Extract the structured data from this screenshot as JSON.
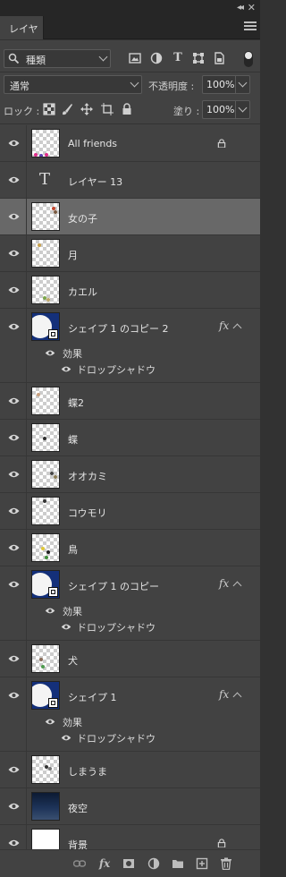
{
  "panel": {
    "tab_label": "レイヤー",
    "filter": {
      "label": "種類"
    },
    "blend_mode": "通常",
    "opacity_label": "不透明度 :",
    "opacity_value": "100%",
    "lock_label": "ロック :",
    "fill_label": "塗り :",
    "fill_value": "100%"
  },
  "layers": [
    {
      "name": "All friends",
      "type": "pixel",
      "locked": true,
      "selected": false
    },
    {
      "name": "レイヤー 13",
      "type": "text",
      "locked": false,
      "selected": false
    },
    {
      "name": "女の子",
      "type": "pixel",
      "locked": false,
      "selected": true
    },
    {
      "name": "月",
      "type": "pixel",
      "locked": false,
      "selected": false
    },
    {
      "name": "カエル",
      "type": "pixel",
      "locked": false,
      "selected": false
    },
    {
      "name": "シェイプ 1 のコピー 2",
      "type": "shape",
      "locked": false,
      "selected": false,
      "has_fx": true,
      "effects_label": "効果",
      "effect_name": "ドロップシャドウ"
    },
    {
      "name": "蝶2",
      "type": "pixel",
      "locked": false,
      "selected": false
    },
    {
      "name": "蝶",
      "type": "pixel",
      "locked": false,
      "selected": false
    },
    {
      "name": "オオカミ",
      "type": "pixel",
      "locked": false,
      "selected": false
    },
    {
      "name": "コウモリ",
      "type": "pixel",
      "locked": false,
      "selected": false
    },
    {
      "name": "鳥",
      "type": "pixel",
      "locked": false,
      "selected": false
    },
    {
      "name": "シェイプ 1 のコピー",
      "type": "shape",
      "locked": false,
      "selected": false,
      "has_fx": true,
      "effects_label": "効果",
      "effect_name": "ドロップシャドウ"
    },
    {
      "name": "犬",
      "type": "pixel",
      "locked": false,
      "selected": false
    },
    {
      "name": "シェイプ 1",
      "type": "shape",
      "locked": false,
      "selected": false,
      "has_fx": true,
      "effects_label": "効果",
      "effect_name": "ドロップシャドウ"
    },
    {
      "name": "しまうま",
      "type": "pixel",
      "locked": false,
      "selected": false
    },
    {
      "name": "夜空",
      "type": "pixel",
      "locked": false,
      "selected": false
    },
    {
      "name": "背景",
      "type": "pixel",
      "locked": true,
      "selected": false
    }
  ]
}
